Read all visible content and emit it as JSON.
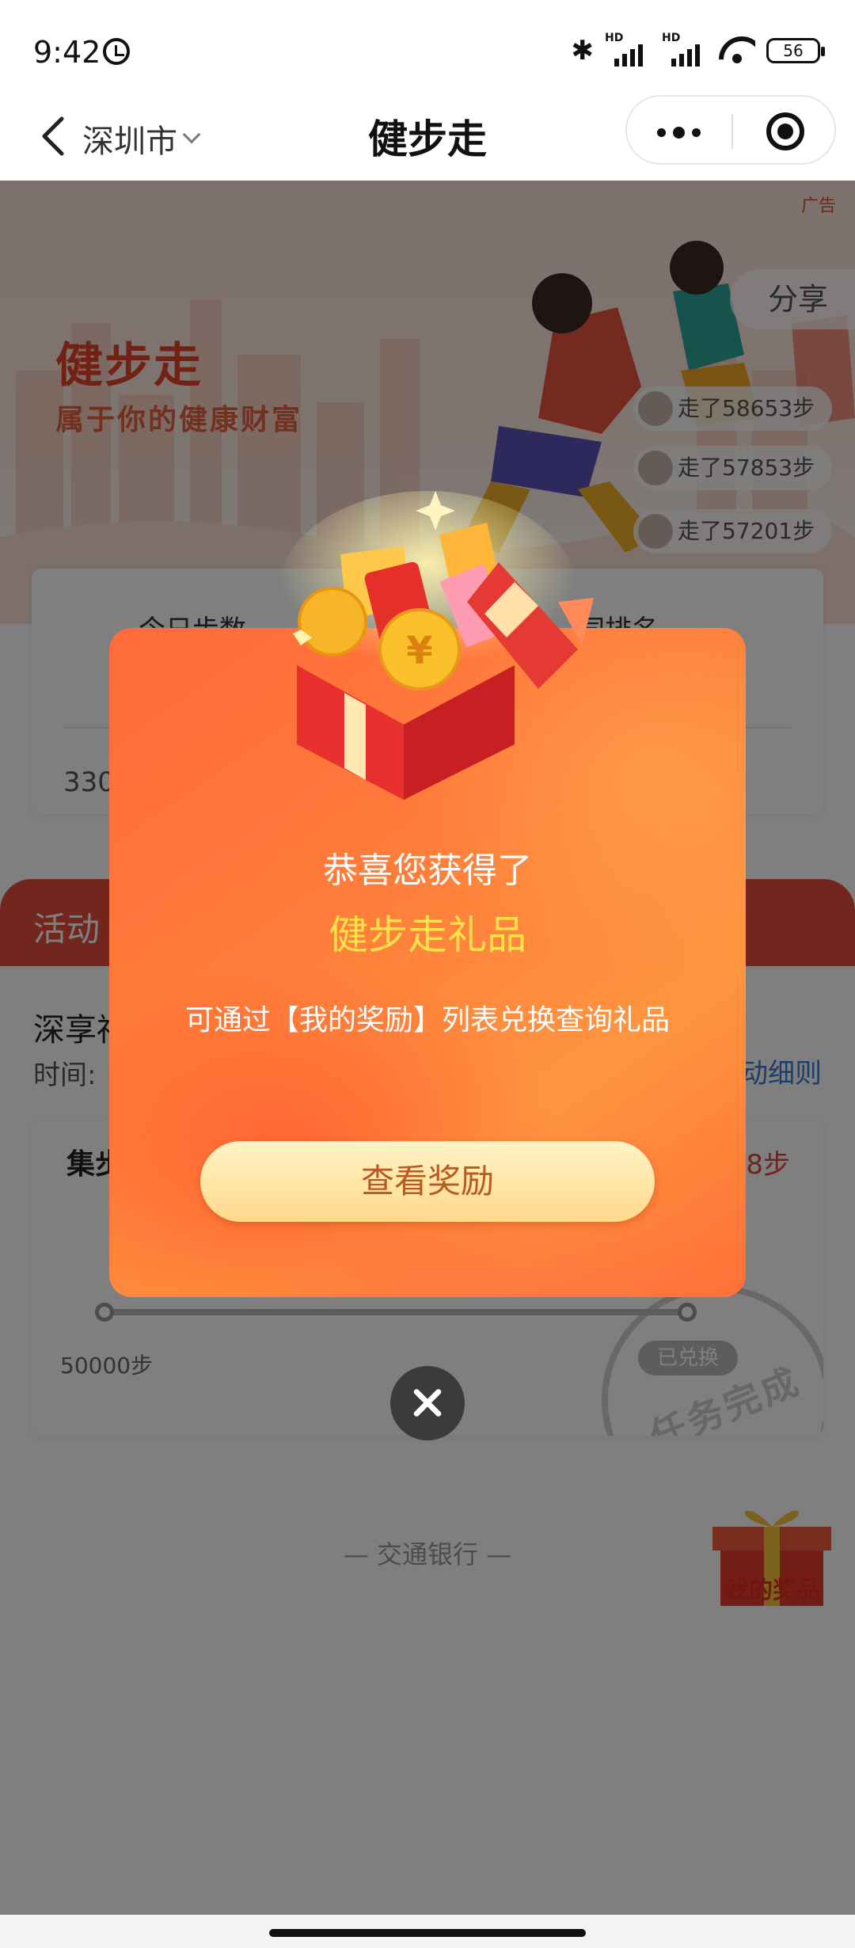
{
  "status_bar": {
    "time": "9:42",
    "battery": "56",
    "signal_label": "HD"
  },
  "nav": {
    "city": "深圳市",
    "title": "健步走"
  },
  "banner": {
    "ad_tag": "广告",
    "title": "健步走",
    "subtitle": "属于你的健康财富",
    "share_label": "分享",
    "walkers": [
      "走了58653步",
      "走了57853步",
      "走了57201步"
    ]
  },
  "steps_card": {
    "today_label": "今日步数",
    "rank_label": "同排名",
    "value": "330"
  },
  "activity": {
    "bar_label": "活动",
    "title": "深享福",
    "time_label": "时间:",
    "rules_link": "动细则"
  },
  "task": {
    "title": "集步",
    "right_value": "8步",
    "milestone": "50000步",
    "redeemed": "已兑换",
    "stamp": "任务完成"
  },
  "footer": {
    "bank": "— 交通银行 —",
    "my_prize": "我的奖品"
  },
  "modal": {
    "congrats": "恭喜您获得了",
    "gift_name": "健步走礼品",
    "hint": "可通过【我的奖励】列表兑换查询礼品",
    "button": "查看奖励"
  },
  "colors": {
    "modal_orange": "#ff7a3a",
    "gift_yellow": "#ffe14a",
    "button_text": "#b85a22",
    "link_blue": "#3a7ad6"
  },
  "icons": [
    "back-icon",
    "chevron-down-icon",
    "more-icon",
    "target-icon",
    "close-icon",
    "gift-box-icon",
    "bluetooth-icon",
    "wifi-icon",
    "battery-icon",
    "alarm-icon"
  ]
}
